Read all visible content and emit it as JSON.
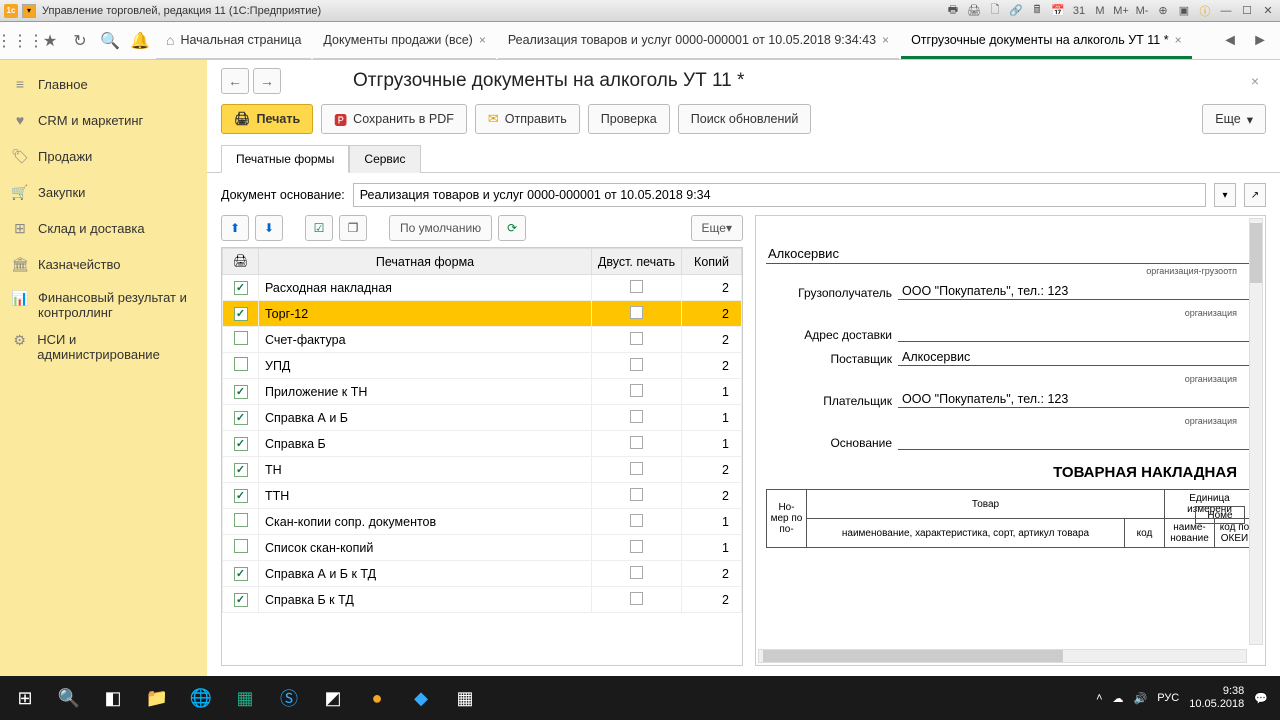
{
  "titlebar": {
    "title": "Управление торговлей, редакция 11 (1С:Предприятие)"
  },
  "tabs": {
    "t1": "Начальная страница",
    "t2": "Документы продажи (все)",
    "t3": "Реализация товаров и услуг 0000-000001 от 10.05.2018 9:34:43",
    "t4": "Отгрузочные документы на алкоголь УТ 11 *"
  },
  "sidebar": {
    "s1": "Главное",
    "s2": "CRM и маркетинг",
    "s3": "Продажи",
    "s4": "Закупки",
    "s5": "Склад и доставка",
    "s6": "Казначейство",
    "s7": "Финансовый результат и контроллинг",
    "s8": "НСИ и администрирование"
  },
  "page": {
    "title": "Отгрузочные документы на алкоголь УТ 11 *"
  },
  "toolbar": {
    "print": "Печать",
    "pdf": "Сохранить в PDF",
    "send": "Отправить",
    "check": "Проверка",
    "update": "Поиск обновлений",
    "more": "Еще"
  },
  "subtabs": {
    "a": "Печатные формы",
    "b": "Сервис"
  },
  "docbase": {
    "label": "Документ основание:",
    "value": "Реализация товаров и услуг 0000-000001 от 10.05.2018 9:34"
  },
  "tblbtn": {
    "default": "По умолчанию",
    "more": "Еще"
  },
  "grid": {
    "h2": "Печатная форма",
    "h3": "Двуст. печать",
    "h4": "Копий",
    "rows": [
      {
        "chk": true,
        "name": "Расходная накладная",
        "cp": "2"
      },
      {
        "chk": true,
        "name": "Торг-12",
        "cp": "2",
        "sel": true
      },
      {
        "chk": false,
        "name": "Счет-фактура",
        "cp": "2"
      },
      {
        "chk": false,
        "name": "УПД",
        "cp": "2"
      },
      {
        "chk": true,
        "name": "Приложение к ТН",
        "cp": "1"
      },
      {
        "chk": true,
        "name": "Справка А и Б",
        "cp": "1"
      },
      {
        "chk": true,
        "name": "Справка Б",
        "cp": "1"
      },
      {
        "chk": true,
        "name": "ТН",
        "cp": "2"
      },
      {
        "chk": true,
        "name": "ТТН",
        "cp": "2"
      },
      {
        "chk": false,
        "name": "Скан-копии сопр. документов",
        "cp": "1"
      },
      {
        "chk": false,
        "name": "Список скан-копий",
        "cp": "1"
      },
      {
        "chk": true,
        "name": "Справка А и Б к ТД",
        "cp": "2"
      },
      {
        "chk": true,
        "name": "Справка Б к ТД",
        "cp": "2"
      }
    ]
  },
  "preview": {
    "org": "Алкосервис",
    "orglabel": "организация-грузоотп",
    "f1l": "Грузополучатель",
    "f1v": "ООО \"Покупатель\", тел.: 123",
    "f1s": "организация",
    "f2l": "Адрес доставки",
    "f2v": "",
    "f3l": "Поставщик",
    "f3v": "Алкосервис",
    "f3s": "организация",
    "f4l": "Плательщик",
    "f4v": "ООО \"Покупатель\", тел.: 123",
    "f4s": "организация",
    "f5l": "Основание",
    "f5v": "",
    "tn": "ТОВАРНАЯ НАКЛАДНАЯ",
    "nome": "Номе",
    "th1": "Но-\nмер\nпо по-",
    "th2": "Товар",
    "th3": "Единица измерени",
    "th2a": "наименование, характеристика, сорт, артикул товара",
    "th2b": "код",
    "th3a": "наиме-\nнование",
    "th3b": "код по\nОКЕИ"
  },
  "tray": {
    "lang": "РУС",
    "time": "9:38",
    "date": "10.05.2018"
  }
}
